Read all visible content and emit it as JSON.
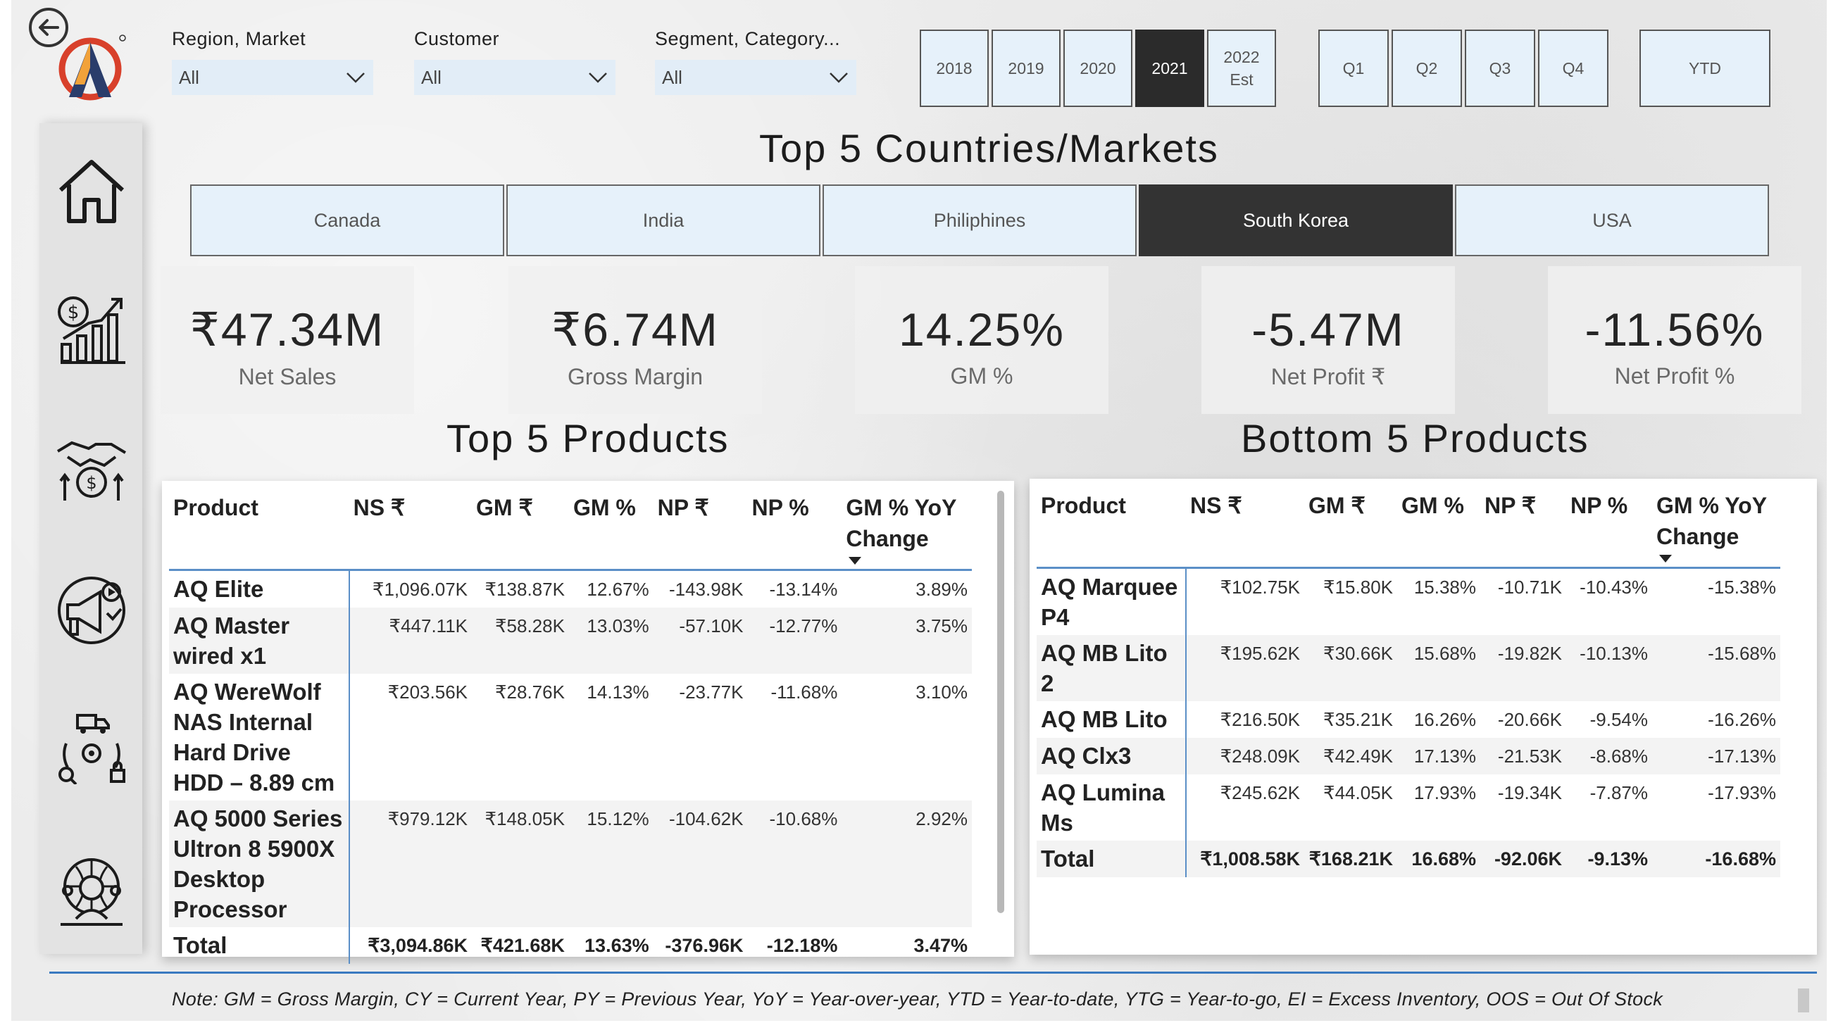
{
  "filters": {
    "region": {
      "label": "Region, Market",
      "value": "All"
    },
    "customer": {
      "label": "Customer",
      "value": "All"
    },
    "segment": {
      "label": "Segment, Category...",
      "value": "All"
    }
  },
  "years": [
    {
      "label": "2018",
      "selected": false
    },
    {
      "label": "2019",
      "selected": false
    },
    {
      "label": "2020",
      "selected": false
    },
    {
      "label": "2021",
      "selected": true
    },
    {
      "label": "2022",
      "sub": "Est",
      "selected": false
    }
  ],
  "quarters": [
    "Q1",
    "Q2",
    "Q3",
    "Q4"
  ],
  "ytd_label": "YTD",
  "countries_title": "Top 5 Countries/Markets",
  "countries": [
    {
      "label": "Canada",
      "selected": false
    },
    {
      "label": "India",
      "selected": false
    },
    {
      "label": "Philiphines",
      "selected": false
    },
    {
      "label": "South Korea",
      "selected": true
    },
    {
      "label": "USA",
      "selected": false
    }
  ],
  "kpis": [
    {
      "value": "₹47.34M",
      "label": "Net Sales"
    },
    {
      "value": "₹6.74M",
      "label": "Gross Margin"
    },
    {
      "value": "14.25%",
      "label": "GM %"
    },
    {
      "value": "-5.47M",
      "label": "Net Profit ₹"
    },
    {
      "value": "-11.56%",
      "label": "Net Profit %"
    }
  ],
  "top_title": "Top 5 Products",
  "bottom_title": "Bottom 5 Products",
  "columns": [
    "Product",
    "NS ₹",
    "GM ₹",
    "GM %",
    "NP ₹",
    "NP %",
    "GM % YoY Change"
  ],
  "top_products": [
    {
      "product": "AQ Elite",
      "ns": "₹1,096.07K",
      "gm": "₹138.87K",
      "gmp": "12.67%",
      "np": "-143.98K",
      "npp": "-13.14%",
      "yoy": "3.89%"
    },
    {
      "product": "AQ Master wired x1",
      "ns": "₹447.11K",
      "gm": "₹58.28K",
      "gmp": "13.03%",
      "np": "-57.10K",
      "npp": "-12.77%",
      "yoy": "3.75%"
    },
    {
      "product": "AQ WereWolf NAS Internal Hard Drive HDD – 8.89 cm",
      "ns": "₹203.56K",
      "gm": "₹28.76K",
      "gmp": "14.13%",
      "np": "-23.77K",
      "npp": "-11.68%",
      "yoy": "3.10%"
    },
    {
      "product": "AQ 5000 Series Ultron 8 5900X Desktop Processor",
      "ns": "₹979.12K",
      "gm": "₹148.05K",
      "gmp": "15.12%",
      "np": "-104.62K",
      "npp": "-10.68%",
      "yoy": "2.92%"
    }
  ],
  "top_total": {
    "product": "Total",
    "ns": "₹3,094.86K",
    "gm": "₹421.68K",
    "gmp": "13.63%",
    "np": "-376.96K",
    "npp": "-12.18%",
    "yoy": "3.47%"
  },
  "bottom_products": [
    {
      "product": "AQ Marquee P4",
      "ns": "₹102.75K",
      "gm": "₹15.80K",
      "gmp": "15.38%",
      "np": "-10.71K",
      "npp": "-10.43%",
      "yoy": "-15.38%"
    },
    {
      "product": "AQ MB Lito 2",
      "ns": "₹195.62K",
      "gm": "₹30.66K",
      "gmp": "15.68%",
      "np": "-19.82K",
      "npp": "-10.13%",
      "yoy": "-15.68%"
    },
    {
      "product": "AQ MB Lito",
      "ns": "₹216.50K",
      "gm": "₹35.21K",
      "gmp": "16.26%",
      "np": "-20.66K",
      "npp": "-9.54%",
      "yoy": "-16.26%"
    },
    {
      "product": "AQ Clx3",
      "ns": "₹248.09K",
      "gm": "₹42.49K",
      "gmp": "17.13%",
      "np": "-21.53K",
      "npp": "-8.68%",
      "yoy": "-17.13%"
    },
    {
      "product": "AQ Lumina Ms",
      "ns": "₹245.62K",
      "gm": "₹44.05K",
      "gmp": "17.93%",
      "np": "-19.34K",
      "npp": "-7.87%",
      "yoy": "-17.93%"
    }
  ],
  "bottom_total": {
    "product": "Total",
    "ns": "₹1,008.58K",
    "gm": "₹168.21K",
    "gmp": "16.68%",
    "np": "-92.06K",
    "npp": "-9.13%",
    "yoy": "-16.68%"
  },
  "note": "Note: GM = Gross Margin, CY = Current Year, PY = Previous Year, YoY = Year-over-year, YTD = Year-to-date, YTG = Year-to-go, EI = Excess Inventory, OOS = Out Of Stock",
  "icons": {
    "back": "back-arrow-icon",
    "nav": [
      "home-icon",
      "finance-growth-icon",
      "handshake-money-icon",
      "marketing-megaphone-icon",
      "supply-chain-icon",
      "support-agent-icon"
    ]
  },
  "colors": {
    "accent_blue": "#3a7ac0",
    "tile_bg": "#e6f1fa",
    "selected_bg": "#2b2b2b"
  }
}
